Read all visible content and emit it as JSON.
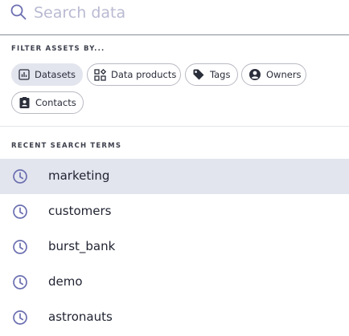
{
  "search": {
    "placeholder": "Search data",
    "value": "",
    "icon": "search-icon"
  },
  "filters": {
    "title": "FILTER ASSETS BY...",
    "chips": [
      {
        "label": "Datasets",
        "icon": "dataset-icon",
        "active": true
      },
      {
        "label": "Data products",
        "icon": "data-products-icon",
        "active": false
      },
      {
        "label": "Tags",
        "icon": "tag-icon",
        "active": false
      },
      {
        "label": "Owners",
        "icon": "owner-icon",
        "active": false
      },
      {
        "label": "Contacts",
        "icon": "contact-icon",
        "active": false
      }
    ]
  },
  "recent": {
    "title": "RECENT SEARCH TERMS",
    "icon": "clock-icon",
    "items": [
      {
        "term": "marketing",
        "highlighted": true
      },
      {
        "term": "customers",
        "highlighted": false
      },
      {
        "term": "burst_bank",
        "highlighted": false
      },
      {
        "term": "demo",
        "highlighted": false
      },
      {
        "term": "astronauts",
        "highlighted": false
      }
    ]
  },
  "colors": {
    "accent": "#6b6fb0",
    "chip_active_bg": "#e3e5ee",
    "row_highlight_bg": "#e3e5ee",
    "placeholder": "#b9bad2"
  }
}
